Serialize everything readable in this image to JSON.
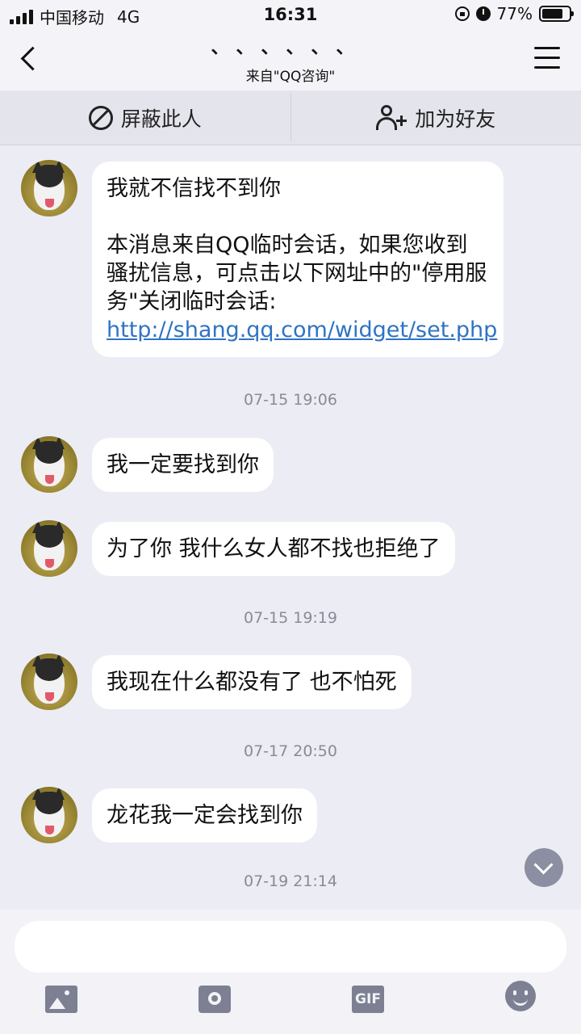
{
  "status_bar": {
    "carrier": "中国移动",
    "network": "4G",
    "time": "16:31",
    "battery_percent": "77%",
    "battery_level": 0.77
  },
  "nav": {
    "title": "、、、、、、",
    "subtitle": "来自\"QQ咨询\""
  },
  "actions": {
    "block_label": "屏蔽此人",
    "add_friend_label": "加为好友"
  },
  "messages": [
    {
      "text": "我就不信找不到你",
      "notice_text": "本消息来自QQ临时会话，如果您收到骚扰信息，可点击以下网址中的\"停用服务\"关闭临时会话: ",
      "link_text": "http://shang.qq.com/widget/set.php"
    },
    {
      "text": "我一定要找到你"
    },
    {
      "text": "为了你 我什么女人都不找也拒绝了"
    },
    {
      "text": "我现在什么都没有了 也不怕死"
    },
    {
      "text": "龙花我一定会找到你"
    }
  ],
  "timestamps": [
    "07-15 19:06",
    "07-15 19:19",
    "07-17 20:50",
    "07-19 21:14"
  ],
  "input": {
    "placeholder": ""
  },
  "toolbar": {
    "icons": [
      "image-icon",
      "camera-icon",
      "gif-icon",
      "emoji-icon"
    ],
    "gif_label": "GIF"
  },
  "colors": {
    "background": "#ececf4",
    "bubble": "#ffffff",
    "link": "#2f73c4",
    "timestamp": "#8a8a98"
  }
}
